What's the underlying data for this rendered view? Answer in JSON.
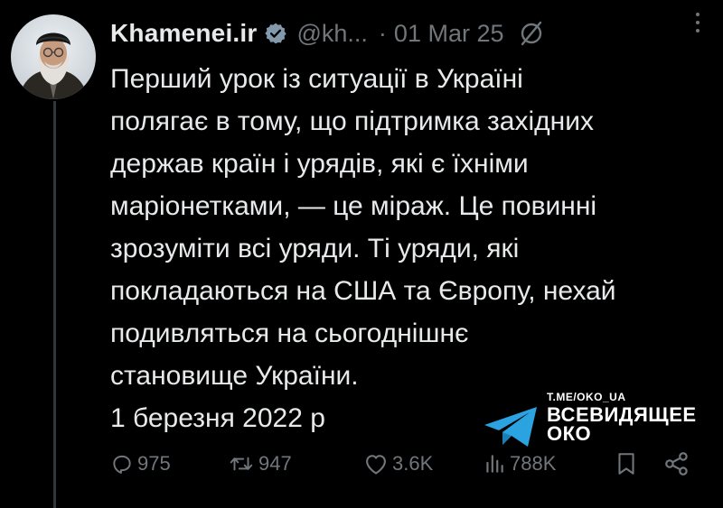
{
  "post": {
    "author_name": "Khamenei.ir",
    "handle": "@kh...",
    "separator": "·",
    "date": "01 Mar 25",
    "text_lines": [
      "Перший урок із ситуації в Україні",
      "полягає в тому, що підтримка західних",
      "держав країн і урядів, які є їхніми",
      "маріонетками, — це міраж. Це повинні",
      "зрозуміти всі уряди. Ті уряди, які",
      "покладаються на США та Європу, нехай",
      "подивляться на сьогоднішнє",
      "становище України."
    ],
    "date_line": "1 березня 2022 р",
    "stats": {
      "replies": "975",
      "reposts": "947",
      "likes": "3.6K",
      "views": "788K"
    }
  },
  "watermark": {
    "url": "T.ME/OKO_UA",
    "title_line1": "ВСЕВИДЯЩЕЕ",
    "title_line2": "ОКО"
  },
  "icons": {
    "verified": "verified-badge-icon",
    "noreply": "replies-restricted-icon",
    "more": "more-options-icon",
    "reply": "reply-icon",
    "repost": "repost-icon",
    "like": "like-icon",
    "views": "views-icon",
    "bookmark": "bookmark-icon",
    "share": "share-icon",
    "telegram": "telegram-icon"
  },
  "colors": {
    "background": "#000000",
    "text": "#e7e9ea",
    "muted": "#71767b",
    "verified_badge": "#829aab",
    "telegram": "#2aa3e0"
  }
}
